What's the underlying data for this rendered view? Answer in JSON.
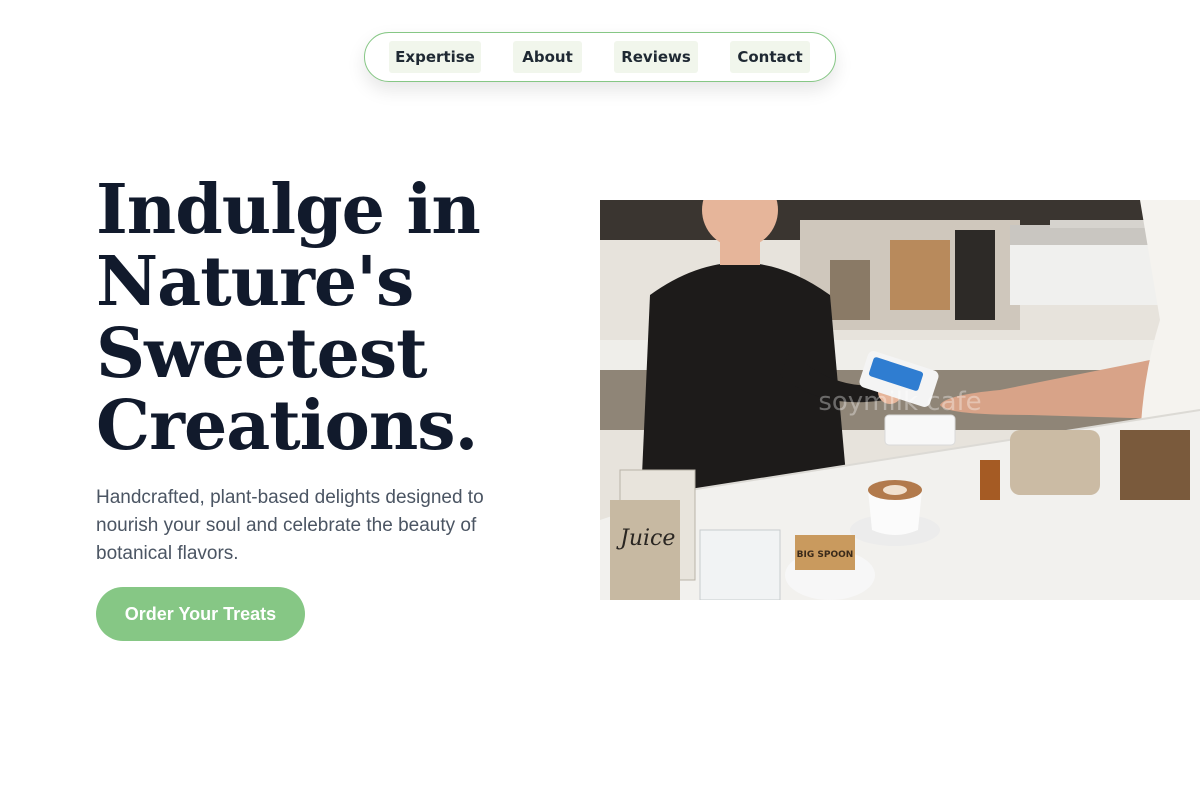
{
  "nav": {
    "items": [
      {
        "label": "Expertise"
      },
      {
        "label": "About"
      },
      {
        "label": "Reviews"
      },
      {
        "label": "Contact"
      }
    ]
  },
  "hero": {
    "title": "Indulge in\nNature's\nSweetest\nCreations.",
    "subtitle": "Handcrafted, plant-based delights designed to nourish your soul and celebrate the beauty of botanical flavors.",
    "cta_label": "Order Your Treats",
    "image": {
      "subject": "cafe-counter-payment-photo",
      "watermark": "soymilk cafe",
      "jar_label": "Juice",
      "bag_label": "BIG SPOON"
    }
  },
  "colors": {
    "accent": "#86c785",
    "nav_item_bg": "#f1f6ec",
    "title": "#111a2c",
    "body_text": "#4b5563"
  }
}
